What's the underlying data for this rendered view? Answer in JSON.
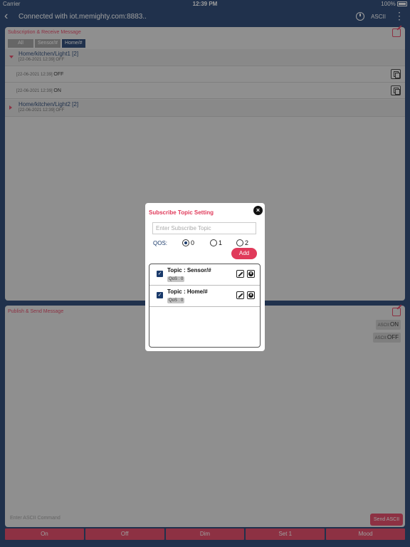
{
  "status_bar": {
    "carrier": "Carrier",
    "time": "12:39 PM",
    "battery": "100%"
  },
  "nav": {
    "back_icon": "chevron-left-icon",
    "title": "Connected with iot.memighty.com:8883..",
    "timer_icon": "timer-icon",
    "ascii_label": "ASCII",
    "more_icon": "more-vertical-icon"
  },
  "subscription": {
    "title": "Subscription & Receive Message",
    "tabs": [
      "All",
      "Sensor/#",
      "Home/#"
    ],
    "active_tab": "Home/#",
    "groups": [
      {
        "topic": "Home/kitchen/Light1 [2]",
        "latest": "[22-06-2021 12:39] OFF",
        "expanded": true,
        "messages": [
          {
            "stamp": "[22-06-2021 12:39]",
            "value": "OFF"
          },
          {
            "stamp": "[22-06-2021 12:39]",
            "value": "ON"
          }
        ]
      },
      {
        "topic": "Home/kitchen/Light2 [2]",
        "latest": "[22-06-2021 12:39] OFF",
        "expanded": false
      }
    ]
  },
  "publish": {
    "title": "Publish & Send Message",
    "ascii_on": {
      "prefix": "ASCII:",
      "value": "ON"
    },
    "ascii_off": {
      "prefix": "ASCII:",
      "value": "OFF"
    },
    "input_placeholder": "Enter ASCII Command",
    "send_label": "Send ASCII"
  },
  "quick_buttons": [
    "On",
    "Off",
    "Dim",
    "Set 1",
    "Mood"
  ],
  "modal": {
    "title": "Subscribe Topic Setting",
    "close_icon": "close-icon",
    "input_placeholder": "Enter Subscribe Topic",
    "qos_label": "QOS:",
    "qos_options": [
      "0",
      "1",
      "2"
    ],
    "qos_selected": "0",
    "add_label": "Add",
    "subscriptions": [
      {
        "topic": "Topic : Sensor/#",
        "qos": "QoS : 0",
        "checked": true
      },
      {
        "topic": "Topic : Home/#",
        "qos": "QoS : 0",
        "checked": true
      }
    ]
  },
  "colors": {
    "navy": "#1a3a6b",
    "accent": "#e03a5a",
    "panel": "#e3e3e3"
  }
}
